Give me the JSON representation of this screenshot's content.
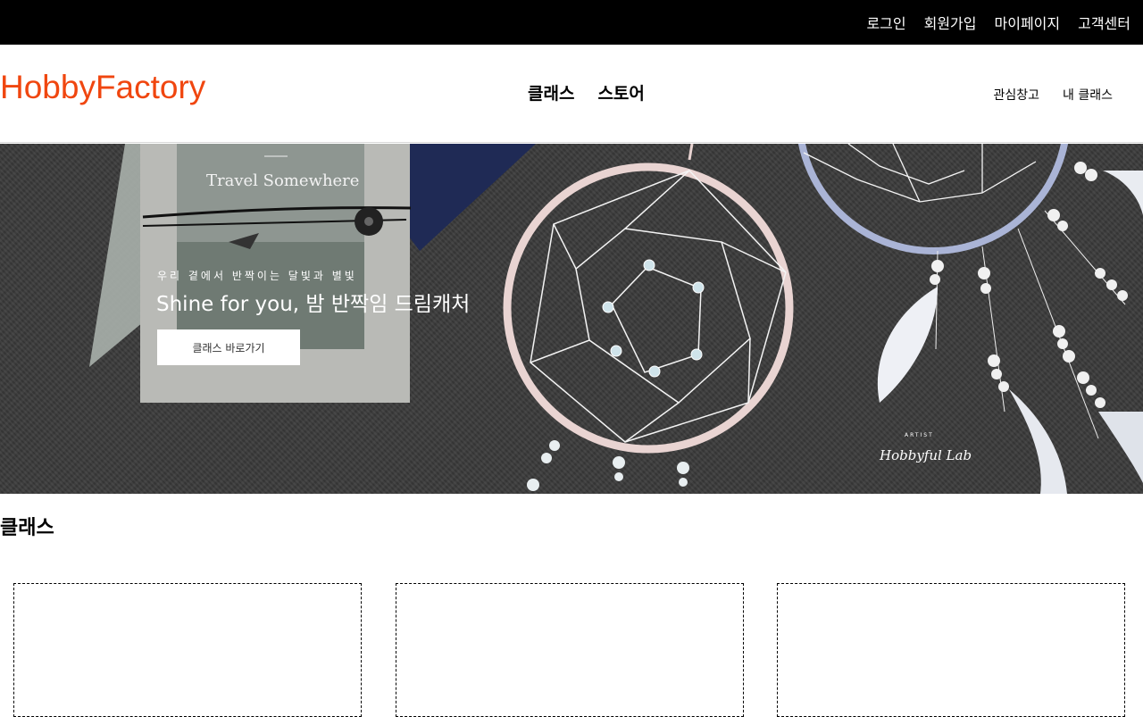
{
  "topbar": {
    "links": [
      "로그인",
      "회원가입",
      "마이페이지",
      "고객센터"
    ]
  },
  "header": {
    "logo": "HobbyFactory",
    "main_nav": [
      "클래스",
      "스토어"
    ],
    "sub_nav": [
      "관심창고",
      "내 클래스"
    ]
  },
  "hero": {
    "subtitle": "우리 곁에서 반짝이는 달빛과 별빛",
    "title": "Shine for you, 밤 반짝임 드림캐처",
    "button": "클래스 바로가기",
    "book_title": "Travel Somewhere",
    "artist_label": "ARTIST",
    "signature": "Hobbyful Lab"
  },
  "section": {
    "title": "클래스",
    "card_count": 3
  },
  "colors": {
    "brand": "#f0460f",
    "topbar_bg": "#000000"
  }
}
